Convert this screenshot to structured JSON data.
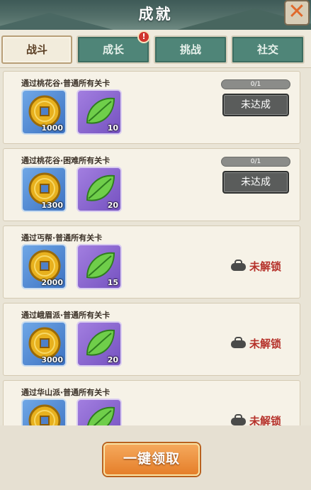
{
  "header": {
    "title": "成就",
    "close_glyph": "✕"
  },
  "tabs": [
    {
      "label": "战斗",
      "active": true,
      "badge": ""
    },
    {
      "label": "成长",
      "active": false,
      "badge": "!"
    },
    {
      "label": "挑战",
      "active": false,
      "badge": ""
    },
    {
      "label": "社交",
      "active": false,
      "badge": ""
    }
  ],
  "achievements": [
    {
      "name": "通过桃花谷·普通所有关卡",
      "rewards": [
        {
          "icon": "copper-coin-icon",
          "count": "1000"
        },
        {
          "icon": "green-leaf-icon",
          "count": "10"
        }
      ],
      "progress": "0/1",
      "status": "未达成"
    },
    {
      "name": "通过桃花谷·困难所有关卡",
      "rewards": [
        {
          "icon": "copper-coin-icon",
          "count": "1300"
        },
        {
          "icon": "green-leaf-icon",
          "count": "20"
        }
      ],
      "progress": "0/1",
      "status": "未达成"
    },
    {
      "name": "通过丐帮·普通所有关卡",
      "rewards": [
        {
          "icon": "copper-coin-icon",
          "count": "2000"
        },
        {
          "icon": "green-leaf-icon",
          "count": "15"
        }
      ],
      "status": "未解锁"
    },
    {
      "name": "通过峨眉派·普通所有关卡",
      "rewards": [
        {
          "icon": "copper-coin-icon",
          "count": "3000"
        },
        {
          "icon": "green-leaf-icon",
          "count": "20"
        }
      ],
      "status": "未解锁"
    },
    {
      "name": "通过华山派·普通所有关卡",
      "rewards": [
        {
          "icon": "copper-coin-icon",
          "count": ""
        },
        {
          "icon": "green-leaf-icon",
          "count": ""
        }
      ],
      "status": "未解锁"
    }
  ],
  "footer": {
    "claim_all_label": "一键领取"
  },
  "colors": {
    "accent": "#e57f2a",
    "tab_active": "#f2ecdc",
    "tab_inactive": "#4f8578",
    "locked_text": "#b5312a"
  }
}
